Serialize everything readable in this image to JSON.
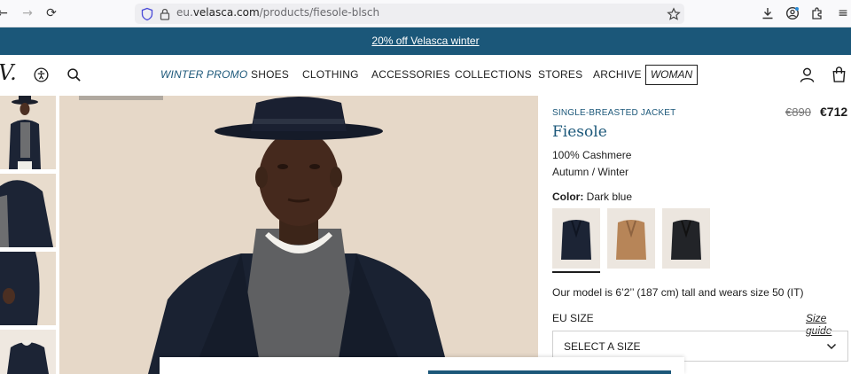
{
  "browser": {
    "url_prefix": "eu.",
    "url_domain": "velasca.com",
    "url_path": "/products/fiesole-blsch",
    "icons": [
      "back-icon",
      "forward-icon",
      "reload-icon",
      "shield-icon",
      "lock-icon",
      "star-icon",
      "download-icon",
      "account-icon",
      "extensions-icon",
      "menu-icon"
    ]
  },
  "promo": {
    "text": "20% off Velasca winter"
  },
  "header": {
    "logo": "V.",
    "menu": [
      "WINTER PROMO",
      "SHOES",
      "CLOTHING",
      "ACCESSORIES",
      "COLLECTIONS",
      "STORES",
      "ARCHIVE"
    ],
    "woman_button": "WOMAN",
    "icons": [
      "accessibility-icon",
      "search-icon",
      "user-icon",
      "bag-icon"
    ]
  },
  "product": {
    "category": "SINGLE-BREASTED JACKET",
    "old_price": "€890",
    "price": "€712",
    "name": "Fiesole",
    "material": "100% Cashmere",
    "season": "Autumn / Winter",
    "color_label": "Color:",
    "color_value": "Dark blue",
    "swatches": [
      "Dark blue",
      "Camel",
      "Black"
    ],
    "model_note": "Our model is 6’2’’ (187 cm) tall and wears size 50 (IT)",
    "size_label": "EU SIZE",
    "size_guide": "Size guide",
    "size_select": "SELECT A SIZE"
  },
  "colors": {
    "brand": "#1b5779",
    "navy": "#1c2435",
    "camel": "#b78558",
    "black": "#222428"
  }
}
